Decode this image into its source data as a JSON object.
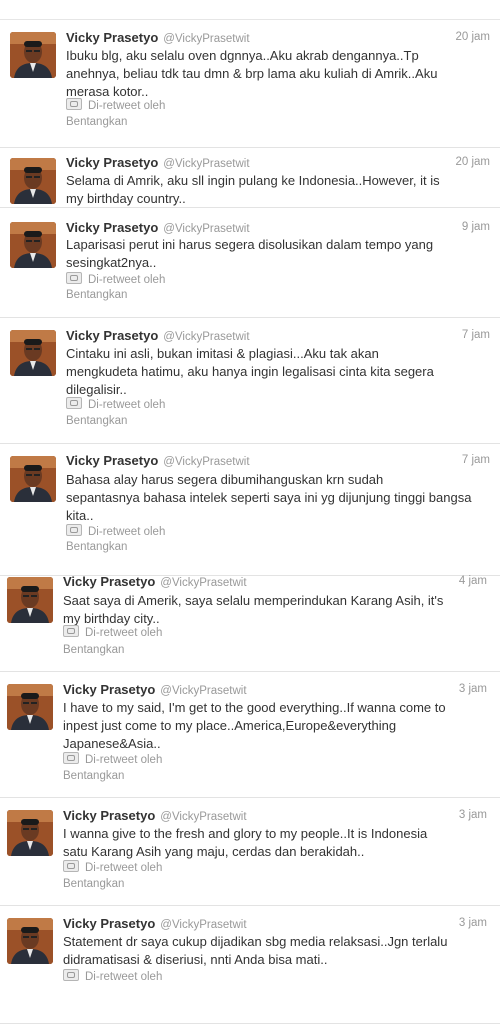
{
  "tweets": [
    {
      "name": "Vicky Prasetyo",
      "handle": "@VickyPrasetwit",
      "time": "20 jam",
      "lines": [
        "Ibuku blg, aku selalu oven dgnnya..Aku akrab dengannya..Tp",
        "anehnya, beliau tdk tau dmn & brp lama aku kuliah di Amrik..Aku",
        "merasa kotor.."
      ],
      "retweet": "Di-retweet oleh",
      "expand": "Bentangkan"
    },
    {
      "name": "Vicky Prasetyo",
      "handle": "@VickyPrasetwit",
      "time": "20 jam",
      "lines": [
        "Selama di Amrik, aku sll ingin pulang ke Indonesia..However, it is",
        "my birthday country.."
      ],
      "retweet": "",
      "expand": ""
    },
    {
      "name": "Vicky Prasetyo",
      "handle": "@VickyPrasetwit",
      "time": "9 jam",
      "lines": [
        "Laparisasi perut ini harus segera disolusikan dalam tempo yang",
        "sesingkat2nya.."
      ],
      "retweet": "Di-retweet oleh",
      "expand": "Bentangkan"
    },
    {
      "name": "Vicky Prasetyo",
      "handle": "@VickyPrasetwit",
      "time": "7 jam",
      "lines": [
        "Cintaku ini asli, bukan imitasi & plagiasi...Aku tak akan",
        "mengkudeta hatimu, aku hanya ingin legalisasi cinta kita segera",
        "dilegalisir.."
      ],
      "retweet": "Di-retweet oleh",
      "expand": "Bentangkan"
    },
    {
      "name": "Vicky Prasetyo",
      "handle": "@VickyPrasetwit",
      "time": "7 jam",
      "lines": [
        "Bahasa alay harus segera dibumihanguskan krn sudah",
        "sepantasnya bahasa intelek seperti saya ini yg dijunjung tinggi bangsa",
        "kita.."
      ],
      "retweet": "Di-retweet oleh",
      "expand": "Bentangkan"
    },
    {
      "name": "Vicky Prasetyo",
      "handle": "@VickyPrasetwit",
      "time": "4 jam",
      "lines": [
        "Saat saya di Amerik, saya selalu memperindukan Karang Asih, it's",
        "my birthday city.."
      ],
      "retweet": "Di-retweet oleh",
      "expand": "Bentangkan"
    },
    {
      "name": "Vicky Prasetyo",
      "handle": "@VickyPrasetwit",
      "time": "3 jam",
      "lines": [
        "I have to my said, I'm get to the good everything..If wanna come to",
        "inpest just come to my place..America,Europe&everything",
        "Japanese&Asia.."
      ],
      "retweet": "Di-retweet oleh",
      "expand": "Bentangkan"
    },
    {
      "name": "Vicky Prasetyo",
      "handle": "@VickyPrasetwit",
      "time": "3 jam",
      "lines": [
        "I wanna give to the fresh and glory to my people..It is Indonesia",
        "satu Karang Asih yang maju, cerdas dan berakidah.."
      ],
      "retweet": "Di-retweet oleh",
      "expand": "Bentangkan"
    },
    {
      "name": "Vicky Prasetyo",
      "handle": "@VickyPrasetwit",
      "time": "3 jam",
      "lines": [
        "Statement dr saya cukup dijadikan sbg media relaksasi..Jgn terlalu",
        "didramatisasi & diseriusi, nnti Anda bisa mati.."
      ],
      "retweet": "Di-retweet oleh",
      "expand": ""
    }
  ]
}
